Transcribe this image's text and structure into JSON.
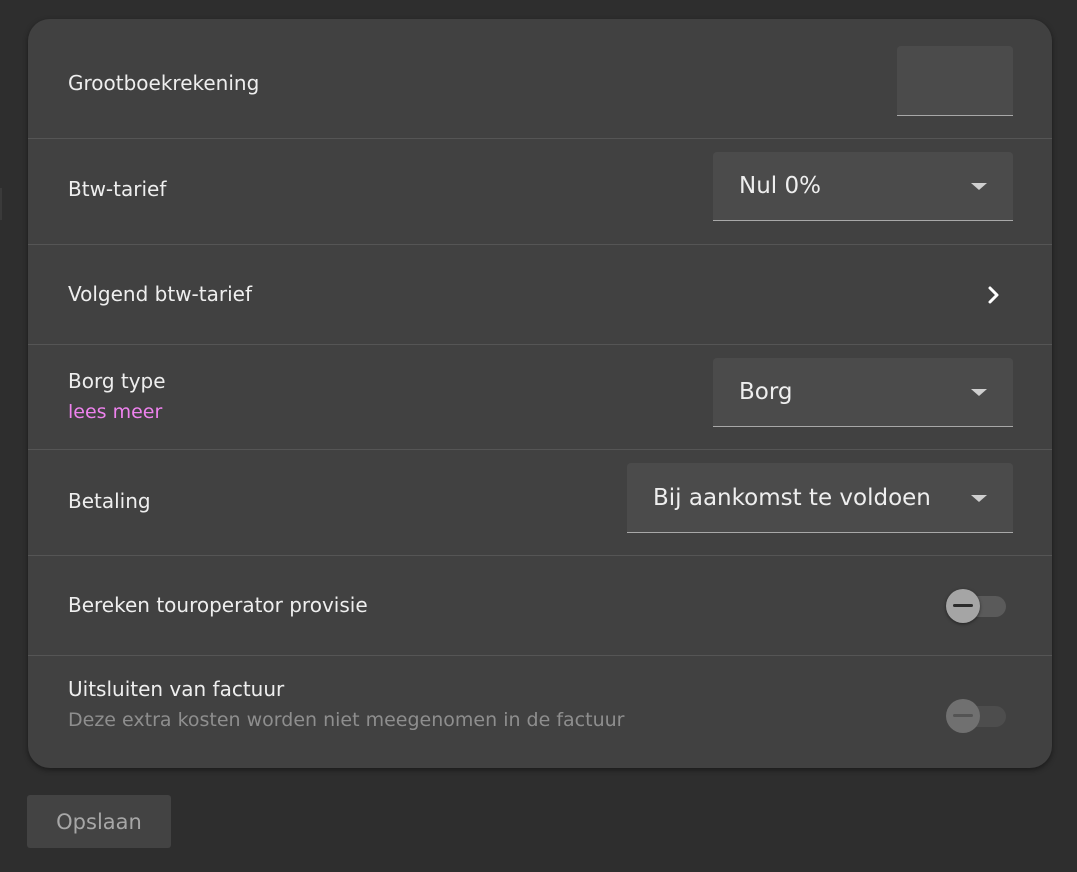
{
  "settings": {
    "ledger": {
      "label": "Grootboekrekening",
      "value": ""
    },
    "vat_rate": {
      "label": "Btw-tarief",
      "selected": "Nul 0%"
    },
    "next_vat_rate": {
      "label": "Volgend btw-tarief",
      "icon": "chevron-right-icon"
    },
    "deposit_type": {
      "label": "Borg type",
      "link": "lees meer",
      "selected": "Borg"
    },
    "payment": {
      "label": "Betaling",
      "selected": "Bij aankomst te voldoen"
    },
    "tour_operator_commission": {
      "label": "Bereken touroperator provisie",
      "enabled": false
    },
    "exclude_from_invoice": {
      "label": "Uitsluiten van factuur",
      "hint": "Deze extra kosten worden niet meegenomen in de factuur",
      "enabled": false,
      "disabled": true
    }
  },
  "actions": {
    "save_label": "Opslaan"
  },
  "colors": {
    "page_background": "#2e2e2e",
    "card_background": "#414141",
    "link": "#ee82ee",
    "text": "#eeeeee",
    "hint_text": "#8e8e8e"
  }
}
